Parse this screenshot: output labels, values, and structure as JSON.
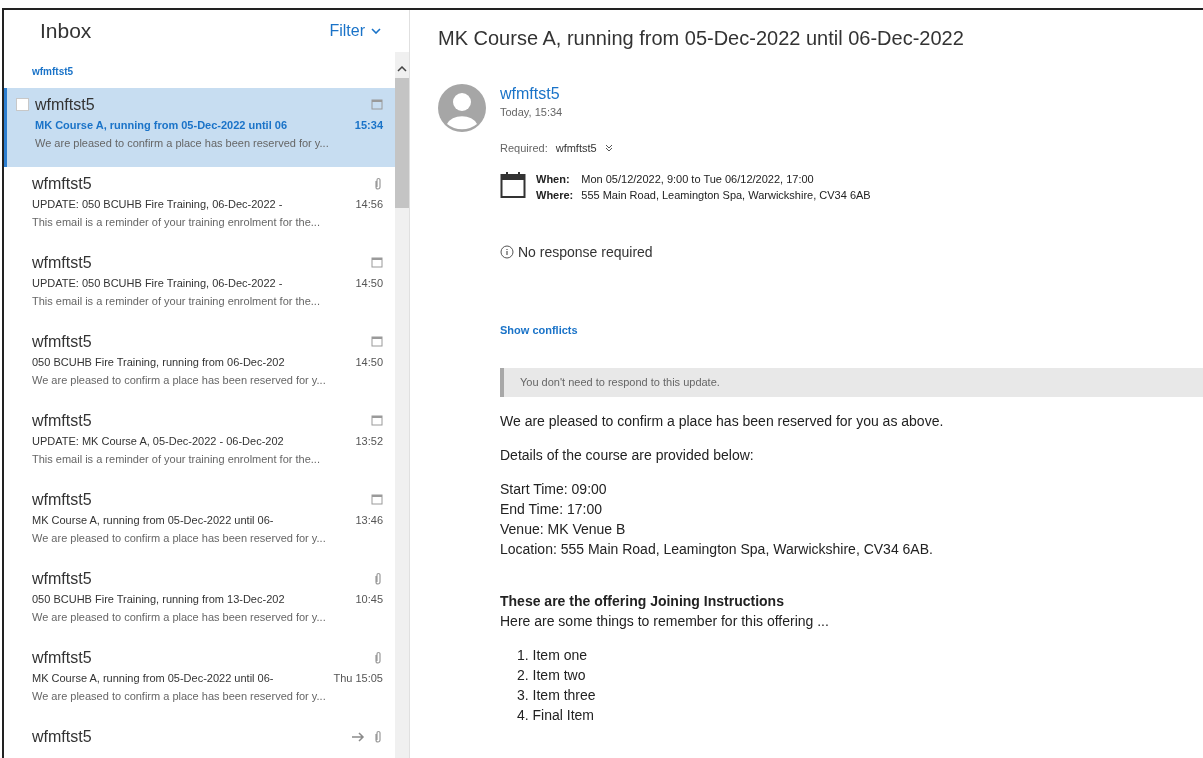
{
  "inbox": {
    "title": "Inbox",
    "filter": "Filter",
    "group_label": "wfmftst5",
    "messages": [
      {
        "sender": "wfmftst5",
        "subject": "MK Course A, running from 05-Dec-2022 until 06",
        "time": "15:34",
        "preview": "We are pleased to confirm a place has been reserved for y...",
        "forwarded": false,
        "attachment": false,
        "calendar": true,
        "selected": true
      },
      {
        "sender": "wfmftst5",
        "subject": "UPDATE: 050 BCUHB Fire Training, 06-Dec-2022 -",
        "time": "14:56",
        "preview": "This email is a reminder of your training enrolment for the...",
        "forwarded": false,
        "attachment": true,
        "calendar": false,
        "selected": false
      },
      {
        "sender": "wfmftst5",
        "subject": "UPDATE: 050 BCUHB Fire Training, 06-Dec-2022 -",
        "time": "14:50",
        "preview": "This email is a reminder of your training enrolment for the...",
        "forwarded": false,
        "attachment": false,
        "calendar": true,
        "selected": false
      },
      {
        "sender": "wfmftst5",
        "subject": "050 BCUHB Fire Training, running from 06-Dec-202",
        "time": "14:50",
        "preview": "We are pleased to confirm a place has been reserved for y...",
        "forwarded": false,
        "attachment": false,
        "calendar": true,
        "selected": false
      },
      {
        "sender": "wfmftst5",
        "subject": "UPDATE: MK Course A, 05-Dec-2022 - 06-Dec-202",
        "time": "13:52",
        "preview": "This email is a reminder of your training enrolment for the...",
        "forwarded": false,
        "attachment": false,
        "calendar": true,
        "selected": false
      },
      {
        "sender": "wfmftst5",
        "subject": "MK Course A, running from 05-Dec-2022 until 06-",
        "time": "13:46",
        "preview": "We are pleased to confirm a place has been reserved for y...",
        "forwarded": false,
        "attachment": false,
        "calendar": true,
        "selected": false
      },
      {
        "sender": "wfmftst5",
        "subject": "050 BCUHB Fire Training, running from 13-Dec-202",
        "time": "10:45",
        "preview": "We are pleased to confirm a place has been reserved for y...",
        "forwarded": false,
        "attachment": true,
        "calendar": false,
        "selected": false
      },
      {
        "sender": "wfmftst5",
        "subject": "MK Course A, running from 05-Dec-2022 until 06-",
        "time": "Thu 15:05",
        "preview": "We are pleased to confirm a place has been reserved for y...",
        "forwarded": false,
        "attachment": true,
        "calendar": false,
        "selected": false
      },
      {
        "sender": "wfmftst5",
        "forwarded": true,
        "attachment": true,
        "calendar": false,
        "selected": false
      }
    ]
  },
  "reading": {
    "subject": "MK Course A, running from 05-Dec-2022 until 06-Dec-2022",
    "sender": "wfmftst5",
    "date": "Today, 15:34",
    "required_label": "Required:",
    "required_value": "wfmftst5",
    "when_label": "When:",
    "when_value": "Mon 05/12/2022, 9:00 to Tue 06/12/2022, 17:00",
    "where_label": "Where:",
    "where_value": "555 Main Road, Leamington Spa, Warwickshire, CV34 6AB",
    "response": "No response required",
    "show_conflicts": "Show conflicts",
    "notice": "You don't need to respond to this update.",
    "body": [
      {
        "kind": "para",
        "text": "We are pleased to confirm a place has been reserved for you as above."
      },
      {
        "kind": "para",
        "text": "Details of the course are provided below:"
      },
      {
        "kind": "lines",
        "lines": [
          "Start Time: 09:00",
          "End Time: 17:00",
          "Venue: MK Venue B",
          "Location: 555 Main Road, Leamington Spa, Warwickshire, CV34 6AB."
        ]
      },
      {
        "kind": "heading",
        "text": "These are the offering Joining Instructions",
        "sub": "Here are some things to remember for this offering ..."
      },
      {
        "kind": "list",
        "lines": [
          "1. Item one",
          "2. Item two",
          "3. Item three",
          "4. Final Item"
        ]
      }
    ]
  }
}
